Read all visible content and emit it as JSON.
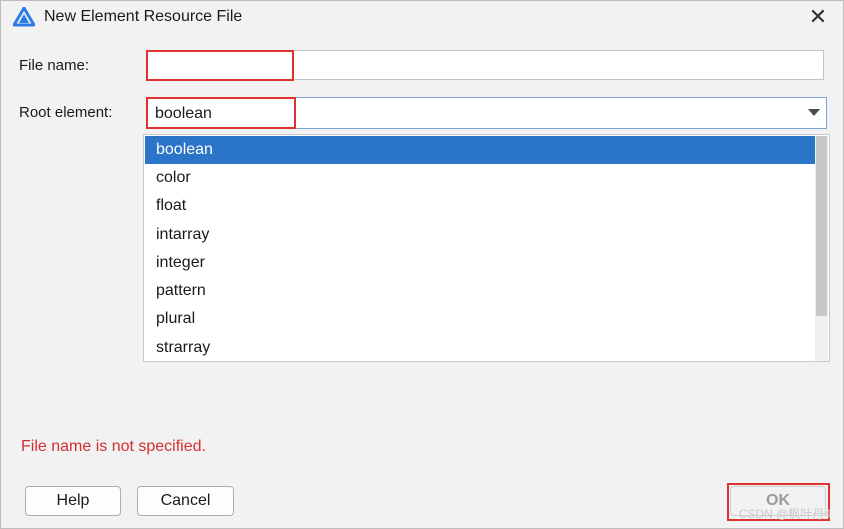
{
  "window": {
    "title": "New Element Resource File",
    "close_symbol": "✕"
  },
  "form": {
    "file_name_label": "File name:",
    "file_name_value": "",
    "root_element_label": "Root element:",
    "root_element_value": "boolean"
  },
  "dropdown": {
    "items": [
      "boolean",
      "color",
      "float",
      "intarray",
      "integer",
      "pattern",
      "plural",
      "strarray"
    ],
    "selected_index": 0
  },
  "error_message": "File name is not specified.",
  "buttons": {
    "help": "Help",
    "cancel": "Cancel",
    "ok": "OK"
  },
  "watermark": "CSDN @枫叶丹4",
  "colors": {
    "selection": "#2a75c7",
    "error": "#d32f2f",
    "highlight": "#e03131"
  }
}
